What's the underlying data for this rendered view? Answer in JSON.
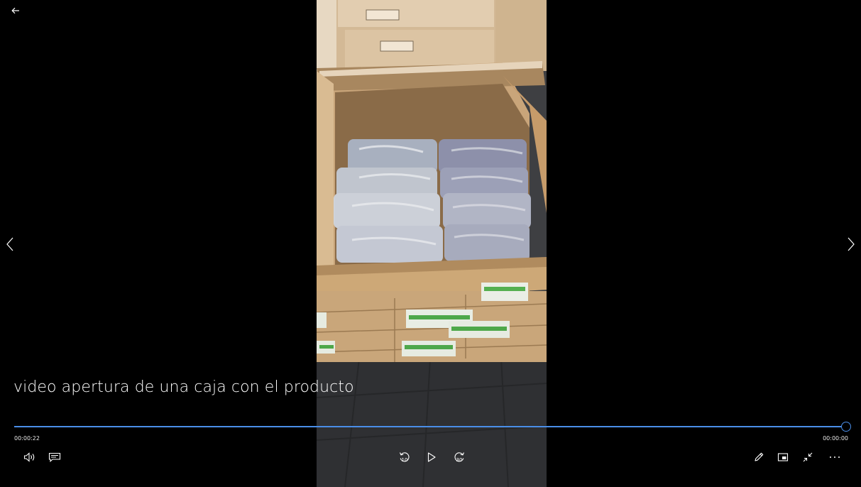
{
  "video": {
    "title": "video apertura de una caja con el producto",
    "elapsed": "00:00:22",
    "total": "00:00:00",
    "progress_fraction": 1.0
  },
  "controls": {
    "skip_back_seconds": "10",
    "skip_forward_seconds": "30"
  },
  "icons": {
    "back": "back-arrow-icon",
    "previous": "chevron-left-icon",
    "next": "chevron-right-icon",
    "volume": "volume-icon",
    "captions": "captions-icon",
    "skip_back": "skip-back-icon",
    "play": "play-icon",
    "skip_forward": "skip-forward-icon",
    "edit": "pencil-icon",
    "mini_view": "mini-view-icon",
    "exit_fullscreen": "exit-fullscreen-icon",
    "more": "more-options-icon"
  },
  "colors": {
    "background": "#000000",
    "accent": "#4a8ee8",
    "track": "#5a5a5a",
    "text": "#ffffff"
  }
}
